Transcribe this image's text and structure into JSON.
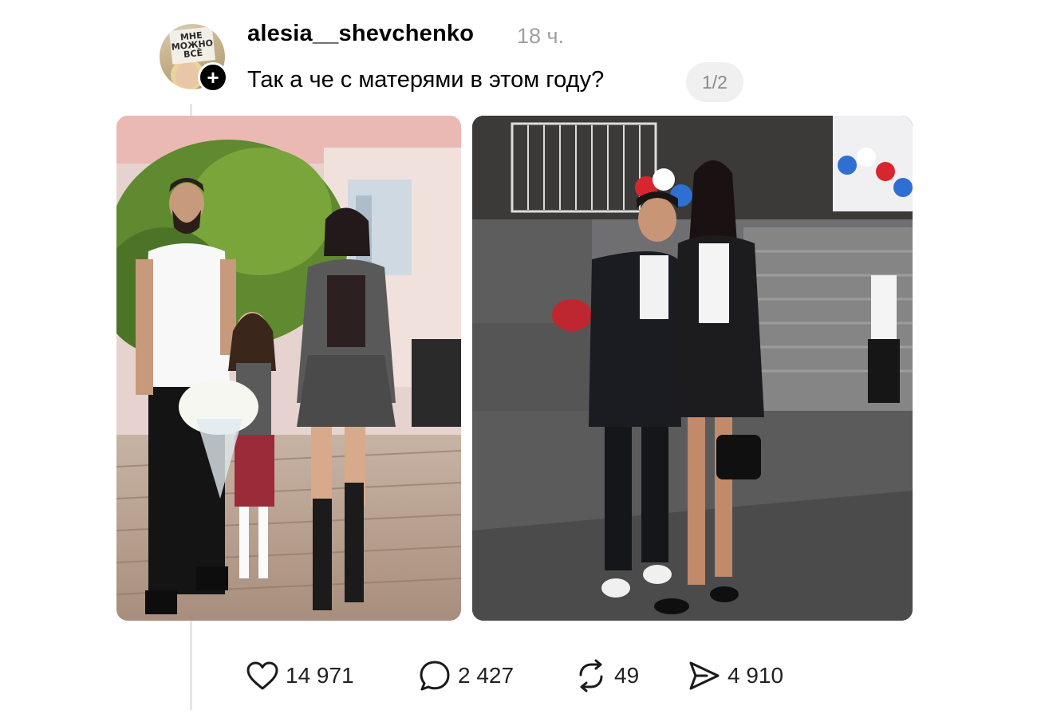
{
  "post": {
    "username": "alesia__shevchenko",
    "time": "18 ч.",
    "text": "Так а че с матерями в этом году?",
    "page_indicator": "1/2",
    "avatar_sign_text": "МНЕ МОЖНО ВСЁ"
  },
  "actions": {
    "likes": "14 971",
    "comments": "2 427",
    "reposts": "49",
    "shares": "4 910"
  },
  "icons": {
    "follow": "plus-icon",
    "like": "heart-icon",
    "comment": "comment-bubble-icon",
    "repost": "repost-icon",
    "share": "send-icon"
  },
  "colors": {
    "background": "#ffffff",
    "text": "#000000",
    "muted": "#a0a0a0",
    "thread_line": "#e5e5e5"
  }
}
